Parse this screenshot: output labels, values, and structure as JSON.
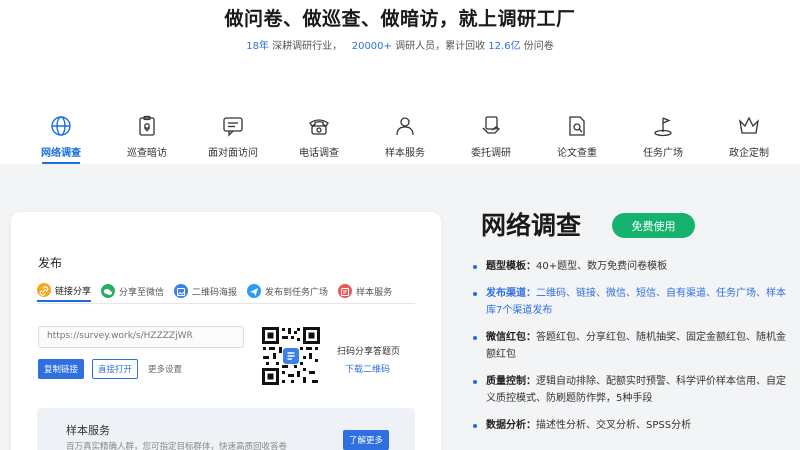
{
  "hero": {
    "title": "做问卷、做巡查、做暗访，就上调研工厂",
    "stat1_num": "18年",
    "stat1_text": "深耕调研行业，",
    "stat2_num": "20000+",
    "stat2_text": "调研人员，累计回收",
    "stat3_num": "12.6亿",
    "stat3_text": "份问卷"
  },
  "tabs": [
    {
      "label": "网络调查",
      "icon": "globe-icon",
      "active": true
    },
    {
      "label": "巡查暗访",
      "icon": "clipboard-location-icon",
      "active": false
    },
    {
      "label": "面对面访问",
      "icon": "chat-bubbles-icon",
      "active": false
    },
    {
      "label": "电话调查",
      "icon": "telephone-icon",
      "active": false
    },
    {
      "label": "样本服务",
      "icon": "users-icon",
      "active": false
    },
    {
      "label": "委托调研",
      "icon": "handshake-icon",
      "active": false
    },
    {
      "label": "论文查重",
      "icon": "document-search-icon",
      "active": false
    },
    {
      "label": "任务广场",
      "icon": "flag-icon",
      "active": false
    },
    {
      "label": "政企定制",
      "icon": "crown-icon",
      "active": false
    }
  ],
  "publish": {
    "title": "发布",
    "options": [
      {
        "label": "链接分享",
        "icon": "link-icon",
        "color": "#f5a623",
        "active": true
      },
      {
        "label": "分享至微信",
        "icon": "wechat-icon",
        "color": "#2aae67",
        "active": false
      },
      {
        "label": "二维码海报",
        "icon": "image-icon",
        "color": "#3d7fe8",
        "active": false
      },
      {
        "label": "发布到任务广场",
        "icon": "send-icon",
        "color": "#2b9cf2",
        "active": false
      },
      {
        "label": "样本服务",
        "icon": "sample-icon",
        "color": "#e85a5a",
        "active": false
      }
    ],
    "url": "https://survey.work/s/HZZZZjWR",
    "copy_label": "复制链接",
    "open_label": "直接打开",
    "more_label": "更多设置",
    "qr_text": "扫码分享答题页",
    "qr_download": "下载二维码",
    "sample_title": "样本服务",
    "sample_desc": "百万真实精确人群，您可指定目标群体，快速高质回收答卷",
    "sample_button": "了解更多"
  },
  "right": {
    "title": "网络调查",
    "cta": "免费使用",
    "features": [
      {
        "key": "题型模板：",
        "text": "40+题型、数万免费问卷模板",
        "blue": false
      },
      {
        "key": "发布渠道：",
        "text": "二维码、链接、微信、短信、自有渠道、任务广场、样本库7个渠道发布",
        "blue": true
      },
      {
        "key": "微信红包：",
        "text": "答题红包、分享红包、随机抽奖、固定金额红包、随机金额红包",
        "blue": false
      },
      {
        "key": "质量控制：",
        "text": "逻辑自动排除、配额实时预警、科学评价样本信用、自定义质控模式、防刷题防作弊，5种手段",
        "blue": false
      },
      {
        "key": "数据分析：",
        "text": "描述性分析、交叉分析、SPSS分析",
        "blue": false
      }
    ]
  },
  "colors": {
    "accent": "#1e6fe0",
    "cta_green": "#16b36e",
    "background_gray": "#f3f4f6"
  }
}
